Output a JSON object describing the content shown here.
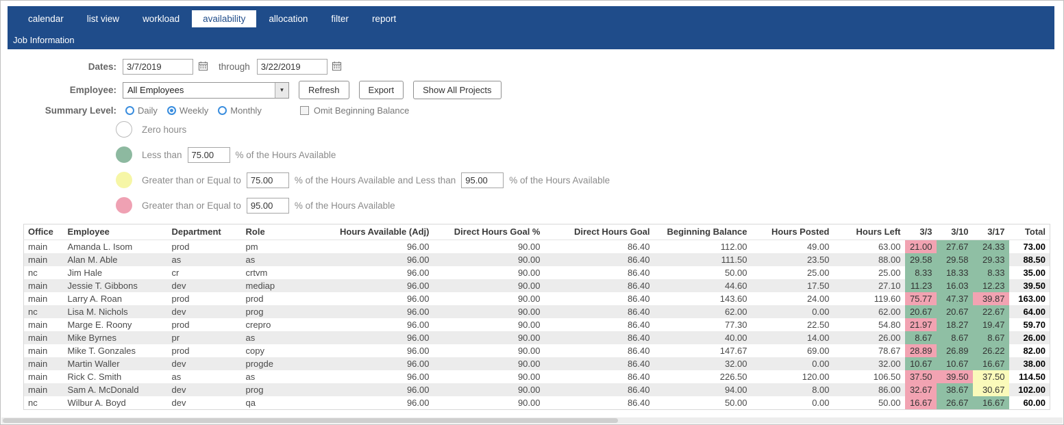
{
  "colors": {
    "nav_blue": "#1f4c8a",
    "cell_green": "#8fbfa4",
    "cell_yellow": "#fafaba",
    "cell_pink": "#f2a3b2",
    "legend_zero": "#ffffff",
    "legend_green": "#8db9a0",
    "legend_yellow": "#f6f6a6",
    "legend_pink": "#efa1b3",
    "alt_row": "#ececec"
  },
  "nav": {
    "tabs": [
      {
        "label": "calendar",
        "active": false
      },
      {
        "label": "list view",
        "active": false
      },
      {
        "label": "workload",
        "active": false
      },
      {
        "label": "availability",
        "active": true
      },
      {
        "label": "allocation",
        "active": false
      },
      {
        "label": "filter",
        "active": false
      },
      {
        "label": "report",
        "active": false
      }
    ],
    "subtitle": "Job Information"
  },
  "filters": {
    "dates_label": "Dates:",
    "date_from": "3/7/2019",
    "through_label": "through",
    "date_to": "3/22/2019",
    "employee_label": "Employee:",
    "employee_value": "All Employees",
    "buttons": {
      "refresh": "Refresh",
      "export": "Export",
      "show_all_projects": "Show All Projects"
    },
    "summary_level_label": "Summary Level:",
    "summary_options": [
      {
        "label": "Daily",
        "selected": false
      },
      {
        "label": "Weekly",
        "selected": true
      },
      {
        "label": "Monthly",
        "selected": false
      }
    ],
    "omit_beginning_balance_label": "Omit Beginning Balance",
    "omit_beginning_balance_checked": false
  },
  "legend": {
    "zero": {
      "label": "Zero hours"
    },
    "less_than": {
      "prefix": "Less than",
      "value": "75.00",
      "suffix": "% of the Hours Available"
    },
    "between": {
      "prefix": "Greater than or Equal to",
      "value_low": "75.00",
      "middle": "% of the Hours Available and Less than",
      "value_high": "95.00",
      "suffix": "% of the Hours Available"
    },
    "greater_equal": {
      "prefix": "Greater than or Equal to",
      "value": "95.00",
      "suffix": "% of the Hours Available"
    }
  },
  "table": {
    "columns": [
      "Office",
      "Employee",
      "Department",
      "Role",
      "Hours Available (Adj)",
      "Direct Hours Goal %",
      "Direct Hours Goal",
      "Beginning Balance",
      "Hours Posted",
      "Hours Left",
      "3/3",
      "3/10",
      "3/17",
      "Total"
    ],
    "rows": [
      {
        "office": "main",
        "employee": "Amanda L. Isom",
        "department": "prod",
        "role": "pm",
        "hours_available": "96.00",
        "direct_hours_goal_pct": "90.00",
        "direct_hours_goal": "86.40",
        "beginning_balance": "112.00",
        "hours_posted": "49.00",
        "hours_left": "63.00",
        "weeks": [
          {
            "value": "21.00",
            "level": "pink"
          },
          {
            "value": "27.67",
            "level": "green"
          },
          {
            "value": "24.33",
            "level": "green"
          }
        ],
        "total": "73.00"
      },
      {
        "office": "main",
        "employee": "Alan M. Able",
        "department": "as",
        "role": "as",
        "hours_available": "96.00",
        "direct_hours_goal_pct": "90.00",
        "direct_hours_goal": "86.40",
        "beginning_balance": "111.50",
        "hours_posted": "23.50",
        "hours_left": "88.00",
        "weeks": [
          {
            "value": "29.58",
            "level": "green"
          },
          {
            "value": "29.58",
            "level": "green"
          },
          {
            "value": "29.33",
            "level": "green"
          }
        ],
        "total": "88.50"
      },
      {
        "office": "nc",
        "employee": "Jim Hale",
        "department": "cr",
        "role": "crtvm",
        "hours_available": "96.00",
        "direct_hours_goal_pct": "90.00",
        "direct_hours_goal": "86.40",
        "beginning_balance": "50.00",
        "hours_posted": "25.00",
        "hours_left": "25.00",
        "weeks": [
          {
            "value": "8.33",
            "level": "green"
          },
          {
            "value": "18.33",
            "level": "green"
          },
          {
            "value": "8.33",
            "level": "green"
          }
        ],
        "total": "35.00"
      },
      {
        "office": "main",
        "employee": "Jessie T. Gibbons",
        "department": "dev",
        "role": "mediap",
        "hours_available": "96.00",
        "direct_hours_goal_pct": "90.00",
        "direct_hours_goal": "86.40",
        "beginning_balance": "44.60",
        "hours_posted": "17.50",
        "hours_left": "27.10",
        "weeks": [
          {
            "value": "11.23",
            "level": "green"
          },
          {
            "value": "16.03",
            "level": "green"
          },
          {
            "value": "12.23",
            "level": "green"
          }
        ],
        "total": "39.50"
      },
      {
        "office": "main",
        "employee": "Larry A. Roan",
        "department": "prod",
        "role": "prod",
        "hours_available": "96.00",
        "direct_hours_goal_pct": "90.00",
        "direct_hours_goal": "86.40",
        "beginning_balance": "143.60",
        "hours_posted": "24.00",
        "hours_left": "119.60",
        "weeks": [
          {
            "value": "75.77",
            "level": "pink"
          },
          {
            "value": "47.37",
            "level": "green"
          },
          {
            "value": "39.87",
            "level": "pink"
          }
        ],
        "total": "163.00"
      },
      {
        "office": "nc",
        "employee": "Lisa M. Nichols",
        "department": "dev",
        "role": "prog",
        "hours_available": "96.00",
        "direct_hours_goal_pct": "90.00",
        "direct_hours_goal": "86.40",
        "beginning_balance": "62.00",
        "hours_posted": "0.00",
        "hours_left": "62.00",
        "weeks": [
          {
            "value": "20.67",
            "level": "green"
          },
          {
            "value": "20.67",
            "level": "green"
          },
          {
            "value": "22.67",
            "level": "green"
          }
        ],
        "total": "64.00"
      },
      {
        "office": "main",
        "employee": "Marge E. Roony",
        "department": "prod",
        "role": "crepro",
        "hours_available": "96.00",
        "direct_hours_goal_pct": "90.00",
        "direct_hours_goal": "86.40",
        "beginning_balance": "77.30",
        "hours_posted": "22.50",
        "hours_left": "54.80",
        "weeks": [
          {
            "value": "21.97",
            "level": "pink"
          },
          {
            "value": "18.27",
            "level": "green"
          },
          {
            "value": "19.47",
            "level": "green"
          }
        ],
        "total": "59.70"
      },
      {
        "office": "main",
        "employee": "Mike Byrnes",
        "department": "pr",
        "role": "as",
        "hours_available": "96.00",
        "direct_hours_goal_pct": "90.00",
        "direct_hours_goal": "86.40",
        "beginning_balance": "40.00",
        "hours_posted": "14.00",
        "hours_left": "26.00",
        "weeks": [
          {
            "value": "8.67",
            "level": "green"
          },
          {
            "value": "8.67",
            "level": "green"
          },
          {
            "value": "8.67",
            "level": "green"
          }
        ],
        "total": "26.00"
      },
      {
        "office": "main",
        "employee": "Mike T. Gonzales",
        "department": "prod",
        "role": "copy",
        "hours_available": "96.00",
        "direct_hours_goal_pct": "90.00",
        "direct_hours_goal": "86.40",
        "beginning_balance": "147.67",
        "hours_posted": "69.00",
        "hours_left": "78.67",
        "weeks": [
          {
            "value": "28.89",
            "level": "pink"
          },
          {
            "value": "26.89",
            "level": "green"
          },
          {
            "value": "26.22",
            "level": "green"
          }
        ],
        "total": "82.00"
      },
      {
        "office": "main",
        "employee": "Martin Waller",
        "department": "dev",
        "role": "progde",
        "hours_available": "96.00",
        "direct_hours_goal_pct": "90.00",
        "direct_hours_goal": "86.40",
        "beginning_balance": "32.00",
        "hours_posted": "0.00",
        "hours_left": "32.00",
        "weeks": [
          {
            "value": "10.67",
            "level": "green"
          },
          {
            "value": "10.67",
            "level": "green"
          },
          {
            "value": "16.67",
            "level": "green"
          }
        ],
        "total": "38.00"
      },
      {
        "office": "main",
        "employee": "Rick C. Smith",
        "department": "as",
        "role": "as",
        "hours_available": "96.00",
        "direct_hours_goal_pct": "90.00",
        "direct_hours_goal": "86.40",
        "beginning_balance": "226.50",
        "hours_posted": "120.00",
        "hours_left": "106.50",
        "weeks": [
          {
            "value": "37.50",
            "level": "pink"
          },
          {
            "value": "39.50",
            "level": "pink"
          },
          {
            "value": "37.50",
            "level": "yellow"
          }
        ],
        "total": "114.50"
      },
      {
        "office": "main",
        "employee": "Sam A. McDonald",
        "department": "dev",
        "role": "prog",
        "hours_available": "96.00",
        "direct_hours_goal_pct": "90.00",
        "direct_hours_goal": "86.40",
        "beginning_balance": "94.00",
        "hours_posted": "8.00",
        "hours_left": "86.00",
        "weeks": [
          {
            "value": "32.67",
            "level": "pink"
          },
          {
            "value": "38.67",
            "level": "green"
          },
          {
            "value": "30.67",
            "level": "yellow"
          }
        ],
        "total": "102.00"
      },
      {
        "office": "nc",
        "employee": "Wilbur A. Boyd",
        "department": "dev",
        "role": "qa",
        "hours_available": "96.00",
        "direct_hours_goal_pct": "90.00",
        "direct_hours_goal": "86.40",
        "beginning_balance": "50.00",
        "hours_posted": "0.00",
        "hours_left": "50.00",
        "weeks": [
          {
            "value": "16.67",
            "level": "pink"
          },
          {
            "value": "26.67",
            "level": "green"
          },
          {
            "value": "16.67",
            "level": "green"
          }
        ],
        "total": "60.00"
      }
    ]
  }
}
